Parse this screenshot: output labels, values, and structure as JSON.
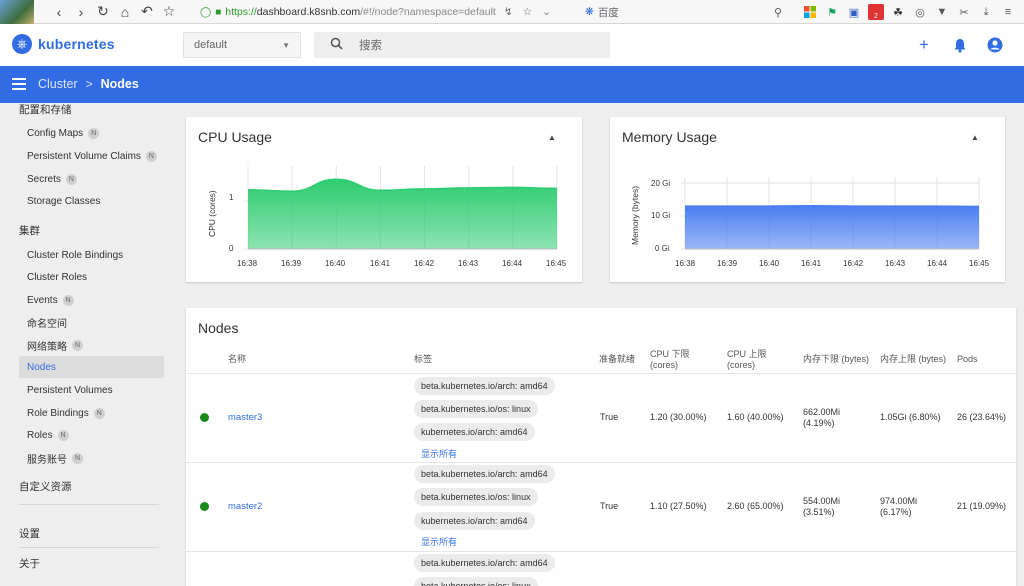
{
  "browser": {
    "url_https": "https://",
    "url_domain": "dashboard.k8snb.com",
    "url_path": "/#!/node?namespace=default",
    "search_engine": "百度",
    "ext_badge": "2"
  },
  "header": {
    "logo_text": "kubernetes",
    "namespace": "default",
    "search_placeholder": "搜索"
  },
  "nav": {
    "breadcrumb_parent": "Cluster",
    "breadcrumb_sep": ">",
    "breadcrumb_current": "Nodes"
  },
  "sidebar": {
    "section_config": "配置和存储",
    "config_items": [
      {
        "label": "Config Maps",
        "badge": "N"
      },
      {
        "label": "Persistent Volume Claims",
        "badge": "N"
      },
      {
        "label": "Secrets",
        "badge": "N"
      },
      {
        "label": "Storage Classes",
        "badge": ""
      }
    ],
    "section_cluster": "集群",
    "cluster_items": [
      {
        "label": "Cluster Role Bindings",
        "badge": ""
      },
      {
        "label": "Cluster Roles",
        "badge": ""
      },
      {
        "label": "Events",
        "badge": "N"
      },
      {
        "label": "命名空间",
        "badge": ""
      },
      {
        "label": "网络策略",
        "badge": "N"
      },
      {
        "label": "Nodes",
        "badge": ""
      },
      {
        "label": "Persistent Volumes",
        "badge": ""
      },
      {
        "label": "Role Bindings",
        "badge": "N"
      },
      {
        "label": "Roles",
        "badge": "N"
      },
      {
        "label": "服务账号",
        "badge": "N"
      }
    ],
    "section_crd": "自定义资源",
    "settings": "设置",
    "about": "关于"
  },
  "cpu_card": {
    "title": "CPU Usage",
    "ylabel": "CPU (cores)",
    "yticks": [
      "1",
      "0"
    ],
    "xticks": [
      "16:38",
      "16:39",
      "16:40",
      "16:41",
      "16:42",
      "16:43",
      "16:44",
      "16:45"
    ]
  },
  "mem_card": {
    "title": "Memory Usage",
    "ylabel": "Memory (bytes)",
    "yticks": [
      "20 Gi",
      "10 Gi",
      "0 Gi"
    ],
    "xticks": [
      "16:38",
      "16:39",
      "16:40",
      "16:41",
      "16:42",
      "16:43",
      "16:44",
      "16:45"
    ]
  },
  "chart_data": [
    {
      "type": "area",
      "title": "CPU Usage",
      "ylabel": "CPU (cores)",
      "x": [
        "16:38",
        "16:39",
        "16:40",
        "16:41",
        "16:42",
        "16:43",
        "16:44",
        "16:45"
      ],
      "values": [
        1.23,
        1.2,
        1.45,
        1.22,
        1.25,
        1.27,
        1.28,
        1.26
      ],
      "ylim": [
        0,
        1.6
      ],
      "color": "#2ecc71"
    },
    {
      "type": "area",
      "title": "Memory Usage",
      "ylabel": "Memory (bytes)",
      "x": [
        "16:38",
        "16:39",
        "16:40",
        "16:41",
        "16:42",
        "16:43",
        "16:44",
        "16:45"
      ],
      "values": [
        13.0,
        13.0,
        13.0,
        13.1,
        13.0,
        13.0,
        13.0,
        12.9
      ],
      "unit": "Gi",
      "ylim": [
        0,
        20
      ],
      "color": "#4a7ef0"
    }
  ],
  "nodes": {
    "title": "Nodes",
    "headers": {
      "name": "名称",
      "labels": "标签",
      "ready": "准备就绪",
      "cpu_req_1": "CPU 下限",
      "cpu_req_2": "(cores)",
      "cpu_lim_1": "CPU 上限",
      "cpu_lim_2": "(cores)",
      "mem_req": "内存下限 (bytes)",
      "mem_lim": "内存上限 (bytes)",
      "pods": "Pods"
    },
    "show_all": "显示所有",
    "rows": [
      {
        "name": "master3",
        "labels": [
          "beta.kubernetes.io/arch: amd64",
          "beta.kubernetes.io/os: linux",
          "kubernetes.io/arch: amd64"
        ],
        "ready": "True",
        "cpu_req": "1.20 (30.00%)",
        "cpu_lim": "1.60 (40.00%)",
        "mem_req_1": "662.00Mi",
        "mem_req_2": "(4.19%)",
        "mem_lim": "1.05Gi (6.80%)",
        "pods": "26 (23.64%)"
      },
      {
        "name": "master2",
        "labels": [
          "beta.kubernetes.io/arch: amd64",
          "beta.kubernetes.io/os: linux",
          "kubernetes.io/arch: amd64"
        ],
        "ready": "True",
        "cpu_req": "1.10 (27.50%)",
        "cpu_lim": "2.60 (65.00%)",
        "mem_req_1": "554.00Mi",
        "mem_req_2": "(3.51%)",
        "mem_lim_1": "974.00Mi",
        "mem_lim_2": "(6.17%)",
        "pods": "21 (19.09%)"
      },
      {
        "labels": [
          "beta.kubernetes.io/arch: amd64",
          "beta.kubernetes.io/os: linux"
        ]
      }
    ]
  }
}
